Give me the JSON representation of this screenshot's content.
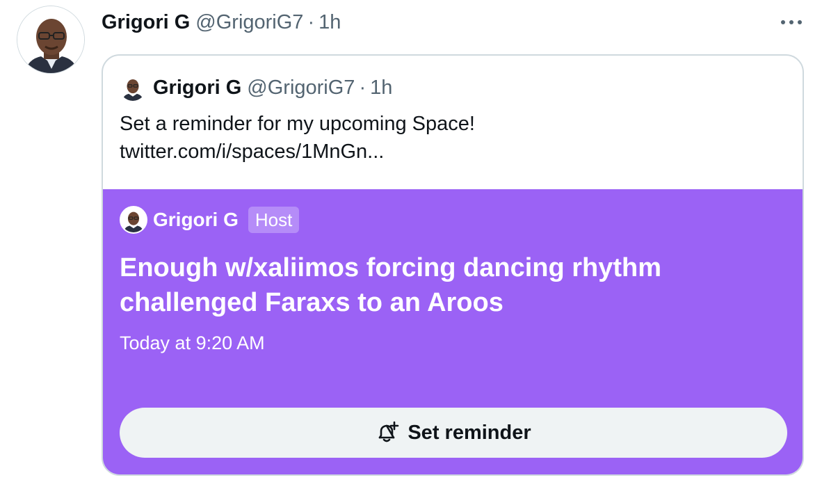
{
  "tweet": {
    "author_name": "Grigori G",
    "author_handle": "@GrigoriG7",
    "separator": "·",
    "time": "1h",
    "more_icon": "more-horizontal-icon"
  },
  "quoted": {
    "author_name": "Grigori G",
    "author_handle": "@GrigoriG7",
    "separator": "·",
    "time": "1h",
    "text_line1": "Set a reminder for my upcoming Space!",
    "text_line2": "twitter.com/i/spaces/1MnGn..."
  },
  "space": {
    "host_name": "Grigori G",
    "host_badge": "Host",
    "title": "Enough w/xaliimos forcing dancing rhythm challenged Faraxs to an Aroos",
    "scheduled": "Today at 9:20 AM",
    "button_label": "Set reminder",
    "button_icon": "bell-plus-icon",
    "card_color": "#9b62f5"
  }
}
